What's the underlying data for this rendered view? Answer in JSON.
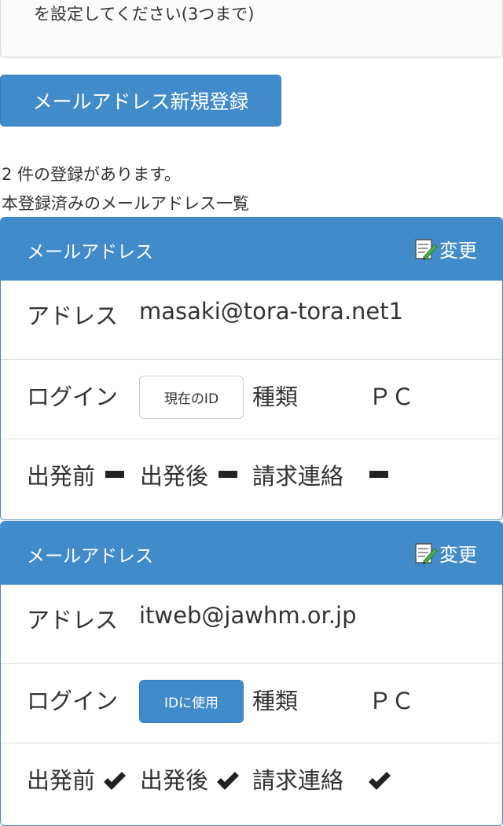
{
  "top_note": "を設定してください(3つまで)",
  "register_button": "メールアドレス新規登録",
  "count_text": "2 件の登録があります。",
  "list_title": "本登録済みのメールアドレス一覧",
  "colors": {
    "primary": "#428bca",
    "border": "#dddddd"
  },
  "cards": [
    {
      "heading": "メールアドレス",
      "edit_label": "変更",
      "edit_icon": "edit-note-icon",
      "address_label": "アドレス",
      "address": "masaki@tora-tora.net1",
      "login_label": "ログイン",
      "login_button": "現在のID",
      "type_label": "種類",
      "type_value": "ＰＣ",
      "before_label": "出発前",
      "after_label": "出発後",
      "billing_label": "請求連絡",
      "before_status": "off",
      "after_status": "off",
      "billing_status": "off"
    },
    {
      "heading": "メールアドレス",
      "edit_label": "変更",
      "edit_icon": "edit-note-icon",
      "address_label": "アドレス",
      "address": "itweb@jawhm.or.jp",
      "login_label": "ログイン",
      "login_button": "IDに使用",
      "type_label": "種類",
      "type_value": "ＰＣ",
      "before_label": "出発前",
      "after_label": "出発後",
      "billing_label": "請求連絡",
      "before_status": "on",
      "after_status": "on",
      "billing_status": "on"
    }
  ]
}
